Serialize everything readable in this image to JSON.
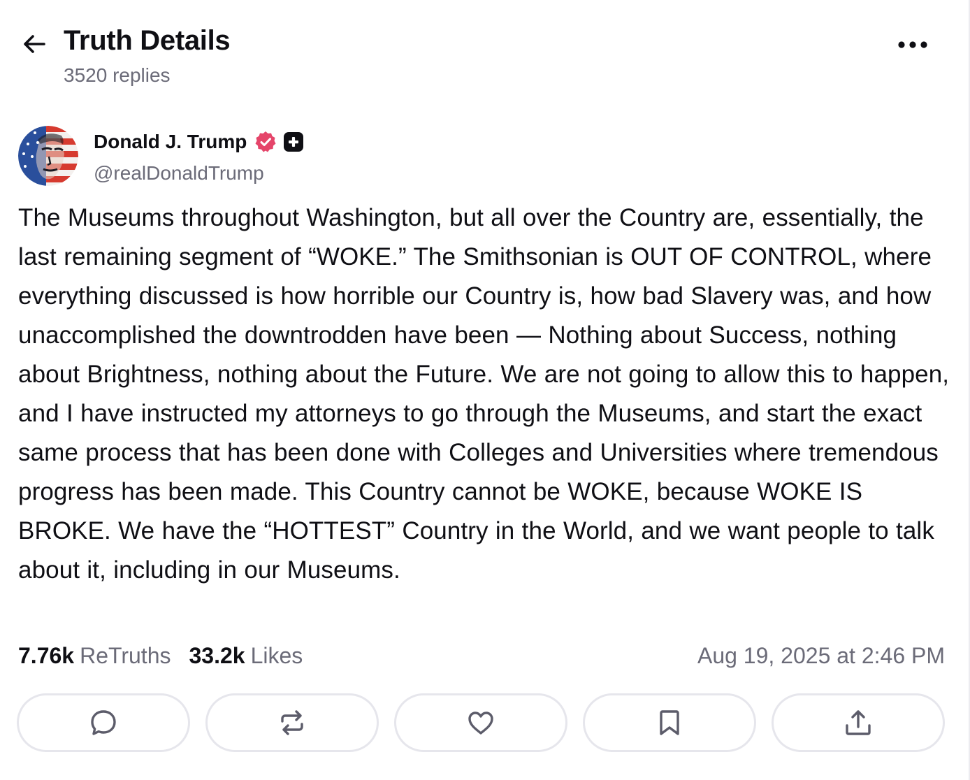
{
  "header": {
    "title": "Truth Details",
    "replies": "3520 replies",
    "back_icon": "arrow-left-icon",
    "more_icon": "more-horizontal-icon"
  },
  "post": {
    "author_name": "Donald J. Trump",
    "handle": "@realDonaldTrump",
    "avatar_icon": "avatar-image",
    "verified_icon": "verified-badge-icon",
    "plus_icon": "truth-plus-badge-icon",
    "text": "The Museums throughout Washington, but all over the Country are, essentially, the last remaining segment of “WOKE.” The Smithsonian is OUT OF CONTROL, where everything discussed is how horrible our Country is, how bad Slavery was, and how unaccomplished the downtrodden have been — Nothing about Success, nothing about Brightness, nothing about the Future. We are not going to allow this to happen, and I have instructed my attorneys to go through the Museums, and start the exact same process that has been done with Colleges and Universities where tremendous progress has been made. This Country cannot be WOKE, because WOKE IS BROKE. We have the “HOTTEST” Country in the World, and we want people to talk about it, including in our Museums.",
    "retruths_count": "7.76k",
    "retruths_label": "ReTruths",
    "likes_count": "33.2k",
    "likes_label": "Likes",
    "timestamp": "Aug 19, 2025 at 2:46 PM"
  },
  "actions": [
    {
      "name": "reply",
      "icon": "comment-icon"
    },
    {
      "name": "retruth",
      "icon": "repost-icon"
    },
    {
      "name": "like",
      "icon": "heart-icon"
    },
    {
      "name": "bookmark",
      "icon": "bookmark-icon"
    },
    {
      "name": "share",
      "icon": "share-icon"
    }
  ],
  "colors": {
    "text": "#0f0f14",
    "muted": "#6b6b78",
    "verified": "#e5456a",
    "border": "#e6e6ec"
  }
}
